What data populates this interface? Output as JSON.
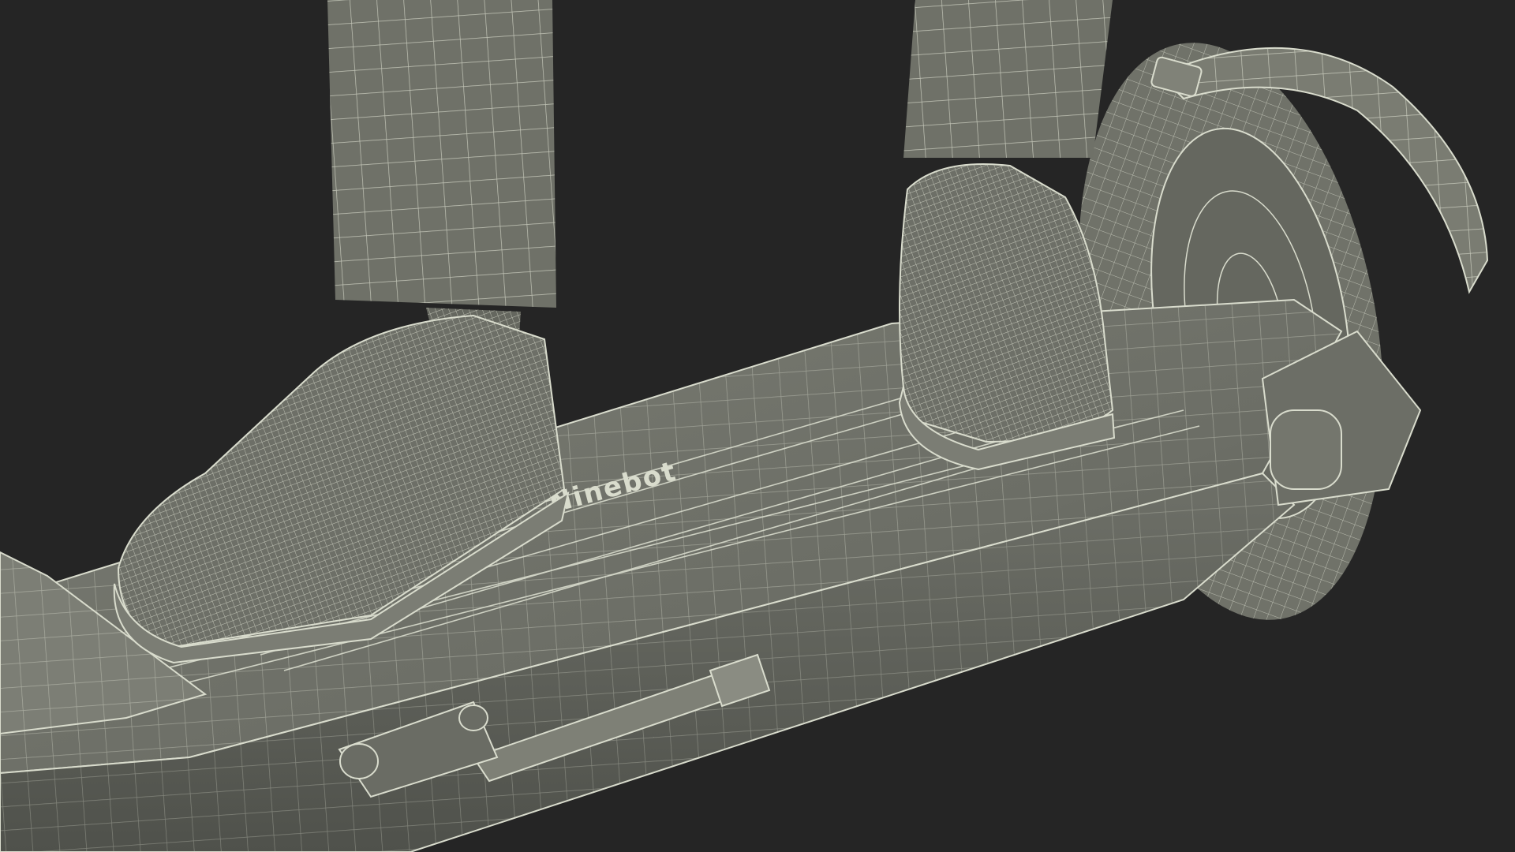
{
  "scene": {
    "description_free": true,
    "colors": {
      "background": "#252525",
      "surface": "#6f7168",
      "surface_light": "#8a8c82",
      "surface_dark": "#54564f",
      "wire": "#d9dccd",
      "wire_dim": "#b9bcad"
    }
  },
  "deck": {
    "logo_text": "Ninebot"
  }
}
